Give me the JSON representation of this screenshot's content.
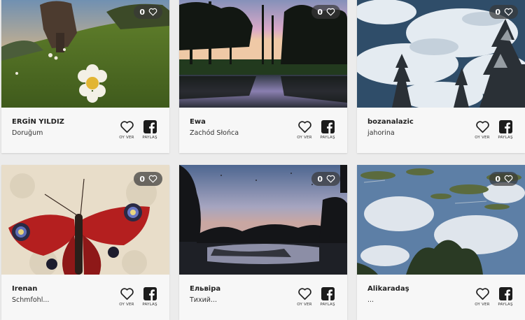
{
  "gallery": {
    "vote_label": "OY VER",
    "share_label": "PAYLAŞ",
    "cards": [
      {
        "likes": "0",
        "author": "ERGİN YILDIZ",
        "title": "Doruğum"
      },
      {
        "likes": "0",
        "author": "Ewa",
        "title": "Zachód Słońca"
      },
      {
        "likes": "0",
        "author": "bozanalazic",
        "title": "jahorina"
      },
      {
        "likes": "0",
        "author": "Irenan",
        "title": "Schmfohl..."
      },
      {
        "likes": "0",
        "author": "Ельвіра",
        "title": "Тихий..."
      },
      {
        "likes": "0",
        "author": "Alikaradaş",
        "title": "..."
      }
    ]
  },
  "icons": {
    "like": "heart-icon",
    "vote": "heart-outline-icon",
    "share": "facebook-icon"
  },
  "colors": {
    "badge_bg": "#373737",
    "card_bg": "#ffffff",
    "info_bg": "#f7f7f7",
    "page_bg": "#ececec"
  }
}
